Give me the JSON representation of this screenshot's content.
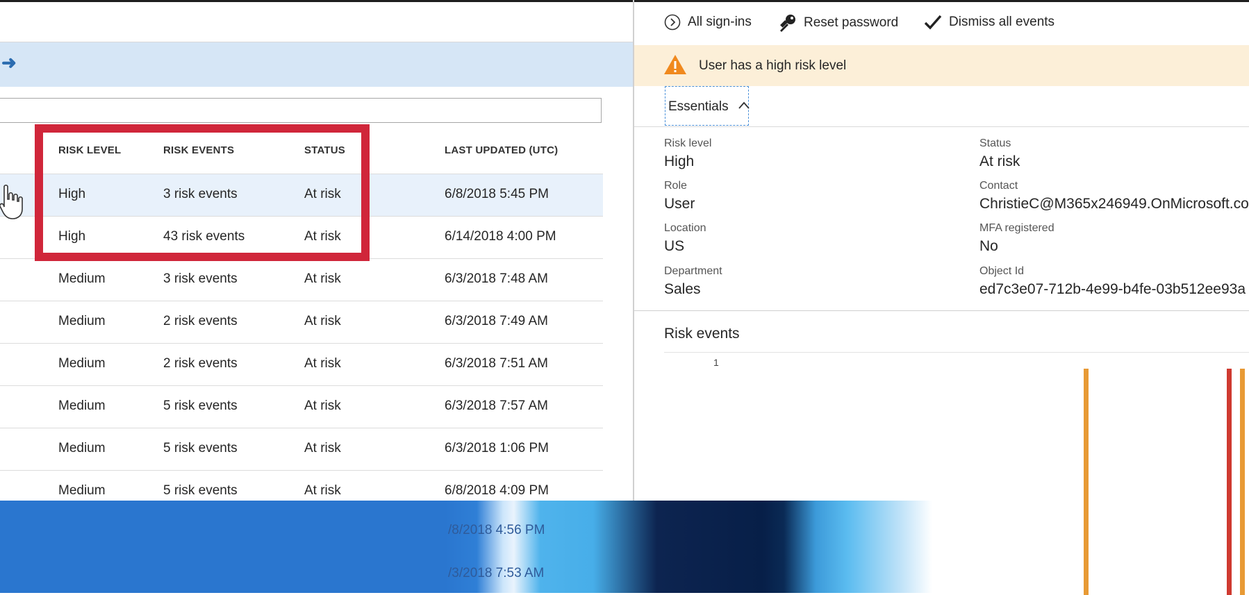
{
  "table": {
    "headers": {
      "risk_level": "RISK LEVEL",
      "risk_events": "RISK EVENTS",
      "status": "STATUS",
      "last_updated": "LAST UPDATED (UTC)"
    },
    "rows": [
      {
        "risk_level": "High",
        "risk_events": "3 risk events",
        "status": "At risk",
        "last_updated": "6/8/2018 5:45 PM"
      },
      {
        "risk_level": "High",
        "risk_events": "43 risk events",
        "status": "At risk",
        "last_updated": "6/14/2018 4:00 PM"
      },
      {
        "risk_level": "Medium",
        "risk_events": "3 risk events",
        "status": "At risk",
        "last_updated": "6/3/2018 7:48 AM"
      },
      {
        "risk_level": "Medium",
        "risk_events": "2 risk events",
        "status": "At risk",
        "last_updated": "6/3/2018 7:49 AM"
      },
      {
        "risk_level": "Medium",
        "risk_events": "2 risk events",
        "status": "At risk",
        "last_updated": "6/3/2018 7:51 AM"
      },
      {
        "risk_level": "Medium",
        "risk_events": "5 risk events",
        "status": "At risk",
        "last_updated": "6/3/2018 7:57 AM"
      },
      {
        "risk_level": "Medium",
        "risk_events": "5 risk events",
        "status": "At risk",
        "last_updated": "6/3/2018 1:06 PM"
      },
      {
        "risk_level": "Medium",
        "risk_events": "5 risk events",
        "status": "At risk",
        "last_updated": "6/8/2018 4:09 PM"
      }
    ],
    "obscured_rows": [
      "/8/2018 4:56 PM",
      "/3/2018 7:53 AM"
    ]
  },
  "toolbar": {
    "all_signins": "All sign-ins",
    "reset_password": "Reset password",
    "dismiss_all": "Dismiss all events"
  },
  "warning": {
    "text": "User has a high risk level"
  },
  "essentials": {
    "title": "Essentials",
    "fields": {
      "risk_level": {
        "label": "Risk level",
        "value": "High"
      },
      "status": {
        "label": "Status",
        "value": "At risk"
      },
      "role": {
        "label": "Role",
        "value": "User"
      },
      "contact": {
        "label": "Contact",
        "value": "ChristieC@M365x246949.OnMicrosoft.co"
      },
      "location": {
        "label": "Location",
        "value": "US"
      },
      "mfa": {
        "label": "MFA registered",
        "value": "No"
      },
      "department": {
        "label": "Department",
        "value": "Sales"
      },
      "object_id": {
        "label": "Object Id",
        "value": "ed7c3e07-712b-4e99-b4fe-03b512ee93a"
      }
    }
  },
  "risk_events": {
    "title": "Risk events",
    "y_tick": "1"
  },
  "colors": {
    "bluebar": "#d6e6f6",
    "warning_bg": "#fcefd8",
    "highlight_box": "#d0263a",
    "bar_orange": "#e89a35",
    "bar_red": "#cf3a30"
  }
}
